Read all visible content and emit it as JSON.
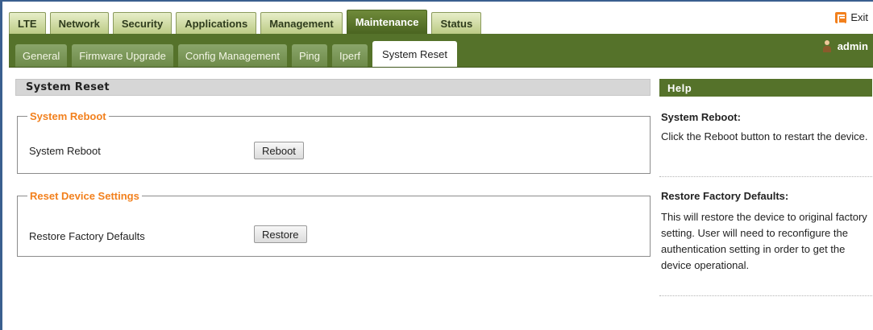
{
  "main_tabs": [
    {
      "label": "LTE",
      "active": false
    },
    {
      "label": "Network",
      "active": false
    },
    {
      "label": "Security",
      "active": false
    },
    {
      "label": "Applications",
      "active": false
    },
    {
      "label": "Management",
      "active": false
    },
    {
      "label": "Maintenance",
      "active": true
    },
    {
      "label": "Status",
      "active": false
    }
  ],
  "exit_label": "Exit",
  "sub_tabs": [
    {
      "label": "General",
      "active": false
    },
    {
      "label": "Firmware Upgrade",
      "active": false
    },
    {
      "label": "Config Management",
      "active": false
    },
    {
      "label": "Ping",
      "active": false
    },
    {
      "label": "Iperf",
      "active": false
    },
    {
      "label": "System Reset",
      "active": true
    }
  ],
  "user": "admin",
  "page_title": "System Reset",
  "reboot_group": {
    "legend": "System Reboot",
    "label": "System Reboot",
    "button": "Reboot"
  },
  "reset_group": {
    "legend": "Reset Device Settings",
    "label": "Restore Factory Defaults",
    "button": "Restore"
  },
  "help": {
    "header": "Help",
    "reboot_title": "System Reboot:",
    "reboot_text": "Click the Reboot button to restart the device.",
    "restore_title": "Restore Factory Defaults:",
    "restore_text": "This will restore the device to original factory setting. User will need to reconfigure the authentication setting in order to get the device operational."
  },
  "colors": {
    "accent_green": "#55722a",
    "legend_orange": "#f2801d",
    "frame_blue": "#3a5f8f"
  }
}
